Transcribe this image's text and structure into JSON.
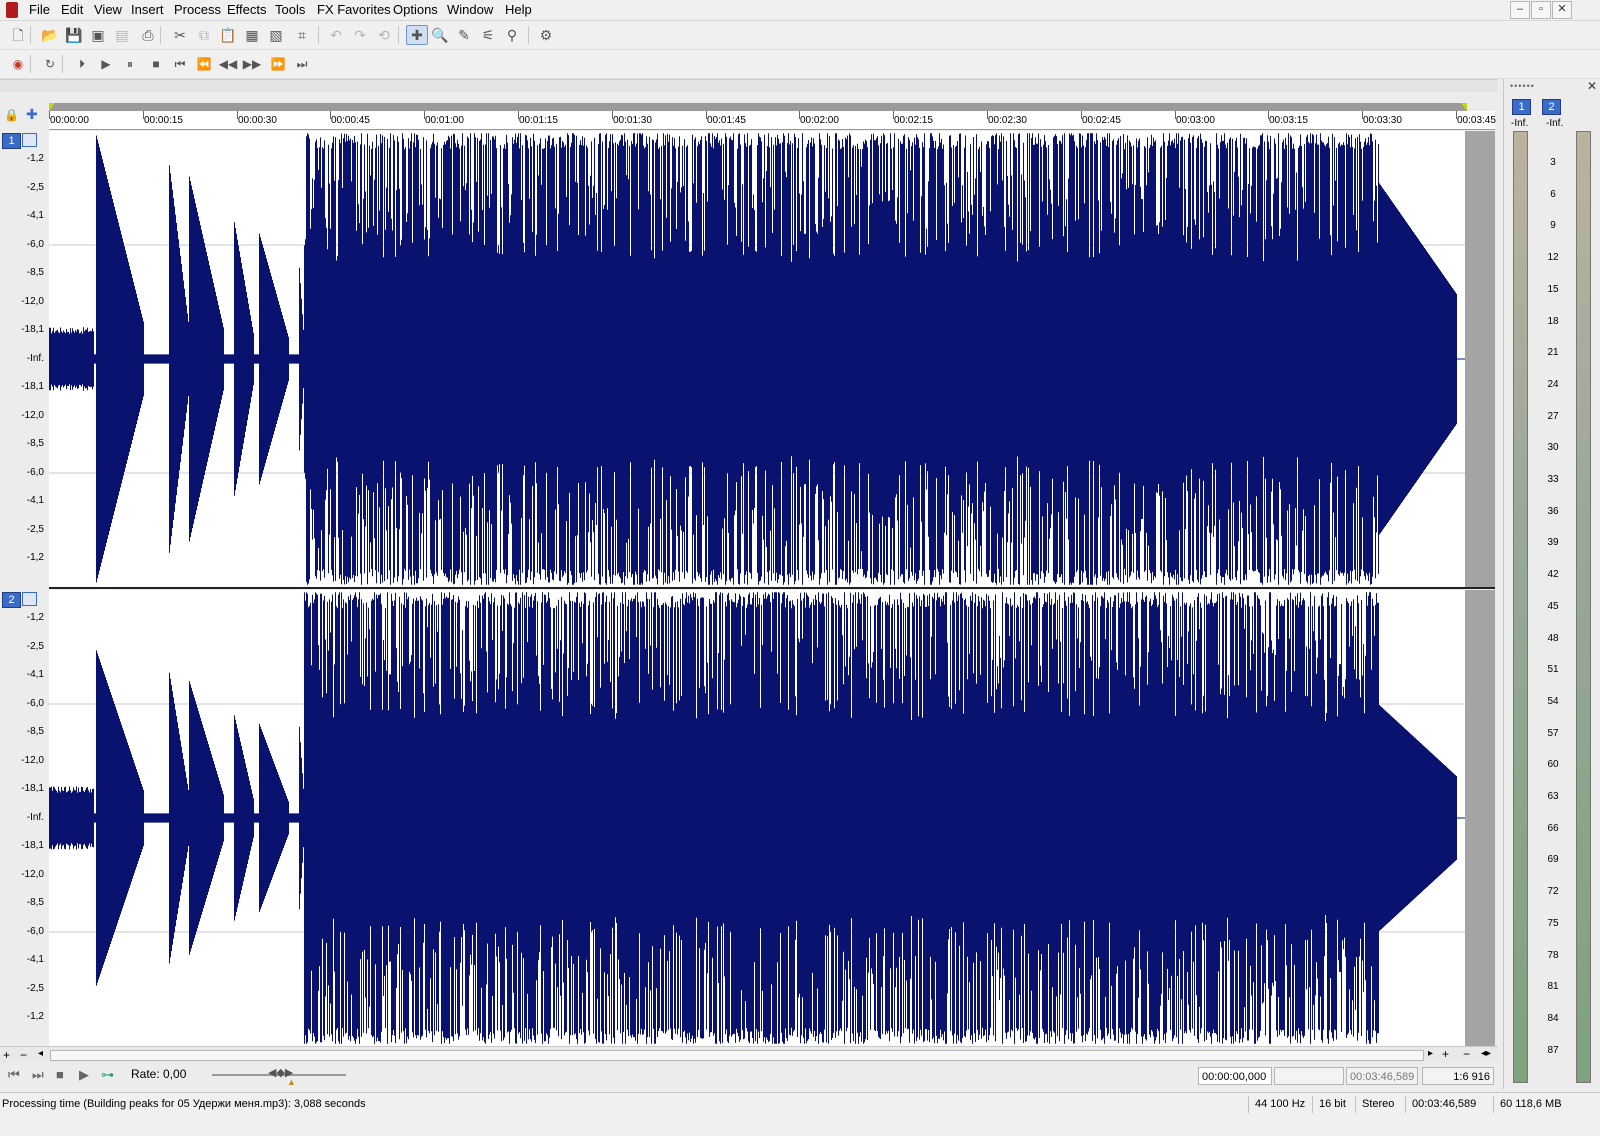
{
  "menu": [
    "File",
    "Edit",
    "View",
    "Insert",
    "Process",
    "Effects",
    "Tools",
    "FX Favorites",
    "Options",
    "Window",
    "Help"
  ],
  "window_buttons": [
    "–",
    "▫",
    "✕"
  ],
  "toolbar1": [
    {
      "name": "new-icon",
      "g": "🗋",
      "dim": false
    },
    {
      "name": "open-icon",
      "g": "📂",
      "dim": false
    },
    {
      "name": "save-icon",
      "g": "💾",
      "dim": false
    },
    {
      "name": "save-as-icon",
      "g": "▣",
      "dim": false
    },
    {
      "name": "save-all-icon",
      "g": "▤",
      "dim": true
    },
    {
      "name": "render-icon",
      "g": "⎙",
      "dim": false
    },
    {
      "name": "cut-icon",
      "g": "✂",
      "dim": false
    },
    {
      "name": "copy-icon",
      "g": "⧉",
      "dim": true
    },
    {
      "name": "paste-icon",
      "g": "📋",
      "dim": false
    },
    {
      "name": "paste-special-icon",
      "g": "▦",
      "dim": false
    },
    {
      "name": "mix-icon",
      "g": "▧",
      "dim": false
    },
    {
      "name": "trim-icon",
      "g": "⌗",
      "dim": false
    },
    {
      "name": "undo-icon",
      "g": "↶",
      "dim": true
    },
    {
      "name": "redo-icon",
      "g": "↷",
      "dim": true
    },
    {
      "name": "repeat-icon",
      "g": "⟲",
      "dim": true
    },
    {
      "name": "edit-tool-icon",
      "g": "✚",
      "dim": false
    },
    {
      "name": "magnify-tool-icon",
      "g": "🔍",
      "dim": false
    },
    {
      "name": "pencil-tool-icon",
      "g": "✎",
      "dim": false
    },
    {
      "name": "envelope-tool-icon",
      "g": "⚟",
      "dim": false
    },
    {
      "name": "smooth-tool-icon",
      "g": "⚲",
      "dim": false
    },
    {
      "name": "plugin-icon",
      "g": "⚙",
      "dim": false
    }
  ],
  "toolbar2": [
    {
      "name": "record-icon",
      "g": "◉"
    },
    {
      "name": "loop-icon",
      "g": "↻"
    },
    {
      "name": "play-all-icon",
      "g": "⏵"
    },
    {
      "name": "play-icon",
      "g": "▶"
    },
    {
      "name": "pause-icon",
      "g": "⏸"
    },
    {
      "name": "stop-icon",
      "g": "■"
    },
    {
      "name": "go-start-icon",
      "g": "⏮"
    },
    {
      "name": "prev-marker-icon",
      "g": "⏪"
    },
    {
      "name": "rewind-icon",
      "g": "◀◀"
    },
    {
      "name": "forward-icon",
      "g": "▶▶"
    },
    {
      "name": "next-marker-icon",
      "g": "⏩"
    },
    {
      "name": "go-end-icon",
      "g": "⏭"
    }
  ],
  "ruler_ticks": [
    "00:00:00",
    "00:00:15",
    "00:00:30",
    "00:00:45",
    "00:01:00",
    "00:01:15",
    "00:01:30",
    "00:01:45",
    "00:02:00",
    "00:02:15",
    "00:02:30",
    "00:02:45",
    "00:03:00",
    "00:03:15",
    "00:03:30",
    "00:03:45"
  ],
  "db_labels": [
    "-1,2",
    "-2,5",
    "-4,1",
    "-6,0",
    "-8,5",
    "-12,0",
    "-18,1",
    "-Inf.",
    "-18,1",
    "-12,0",
    "-8,5",
    "-6,0",
    "-4,1",
    "-2,5",
    "-1,2"
  ],
  "channels": [
    "1",
    "2"
  ],
  "meter": {
    "channels": [
      "1",
      "2"
    ],
    "peak": [
      "-Inf.",
      "-Inf."
    ],
    "scale": [
      "3",
      "6",
      "9",
      "12",
      "15",
      "18",
      "21",
      "24",
      "27",
      "30",
      "33",
      "36",
      "39",
      "42",
      "45",
      "48",
      "51",
      "54",
      "57",
      "60",
      "63",
      "66",
      "69",
      "72",
      "75",
      "78",
      "81",
      "84",
      "87"
    ]
  },
  "transport": {
    "rate_label": "Rate: 0,00",
    "selection_start": "00:00:00,000",
    "selection_end": "",
    "length": "00:03:46,589",
    "zoom": "1:6 916"
  },
  "statusbar": {
    "message": "Processing time (Building peaks for 05 Удержи меня.mp3): 3,088 seconds",
    "sample_rate": "44 100 Hz",
    "bit_depth": "16 bit",
    "channels": "Stereo",
    "duration": "00:03:46,589",
    "disk": "60 118,6 MB"
  },
  "colors": {
    "waveform": "#0a1270",
    "meter_top": "#bcb29e",
    "meter_bottom": "#7fa27c",
    "channel_badge": "#3b6bc8"
  }
}
